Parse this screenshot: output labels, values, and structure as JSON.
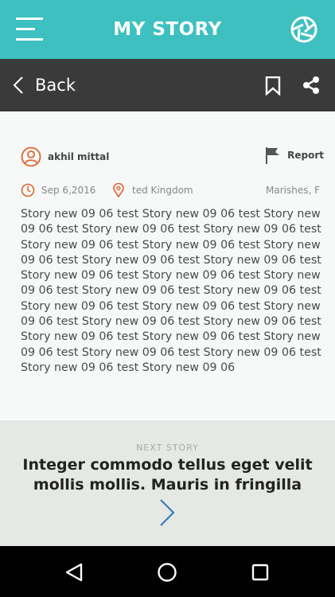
{
  "header": {
    "title": "MY STORY"
  },
  "subbar": {
    "back_label": "Back"
  },
  "story": {
    "author": "akhil mittal",
    "report_label": "Report",
    "date": "Sep 6,2016",
    "location": "ted Kingdom",
    "extra": "Marishes, F",
    "body": "Story new 09 06 test Story new 09 06 test Story new 09 06 test Story new 09 06 test Story new 09 06 test Story new 09 06 test Story new 09 06 test Story new 09 06 test Story new 09 06 test Story new 09 06 test Story new 09 06 test Story new 09 06 test Story new 09 06 test Story new 09 06 test Story new 09 06 test Story new 09 06 test Story new 09 06 test Story new 09 06 test Story new 09 06 test Story new 09 06 test Story new 09 06 test Story new 09 06 test Story new 09 06 test Story new 09 06 test Story new 09 06 test Story new 09 06 test Story new 09 06"
  },
  "next": {
    "label": "NEXT STORY",
    "title": "Integer commodo tellus eget velit mollis mollis. Mauris in fringilla"
  },
  "colors": {
    "primary": "#3dc0bf",
    "subbar": "#3a3a3a",
    "accent": "#e0642f"
  }
}
